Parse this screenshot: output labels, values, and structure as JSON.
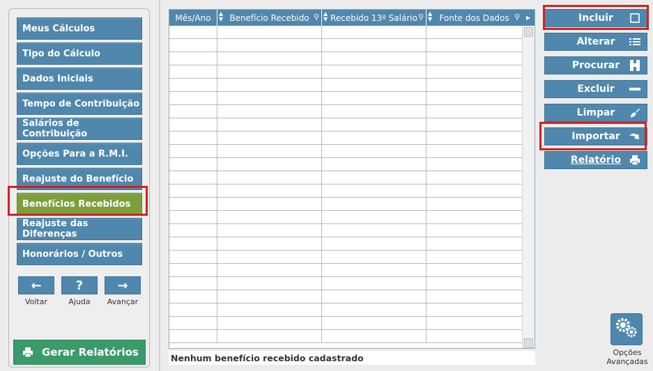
{
  "sidebar": {
    "items": [
      {
        "label": "Meus Cálculos"
      },
      {
        "label": "Tipo do Cálculo"
      },
      {
        "label": "Dados Iniciais"
      },
      {
        "label": "Tempo de Contribuição"
      },
      {
        "label": "Salários de Contribuição"
      },
      {
        "label": "Opções Para a R.M.I."
      },
      {
        "label": "Reajuste do Benefício"
      },
      {
        "label": "Benefícios Recebidos",
        "active": true
      },
      {
        "label": "Reajuste das Diferenças"
      },
      {
        "label": "Honorários / Outros"
      }
    ],
    "nav": {
      "back_label": "Voltar",
      "help_label": "Ajuda",
      "forward_label": "Avançar"
    },
    "generate_reports_label": "Gerar Relatórios"
  },
  "grid": {
    "columns": [
      "Mês/Ano",
      "Benefício Recebido",
      "Recebido 13º Salário",
      "Fonte dos Dados"
    ],
    "rows": [],
    "status_text": "Nenhum benefício recebido cadastrado"
  },
  "actions": {
    "include": "Incluir",
    "edit": "Alterar",
    "search": "Procurar",
    "delete": "Excluir",
    "clear": "Limpar",
    "import": "Importar",
    "report": "Relatório"
  },
  "advanced": {
    "line1": "Opções",
    "line2": "Avançadas"
  },
  "colors": {
    "button_blue": "#4f87ad",
    "active_green": "#7ba03b",
    "report_green": "#3a9a6a",
    "highlight_red": "#d42020"
  }
}
